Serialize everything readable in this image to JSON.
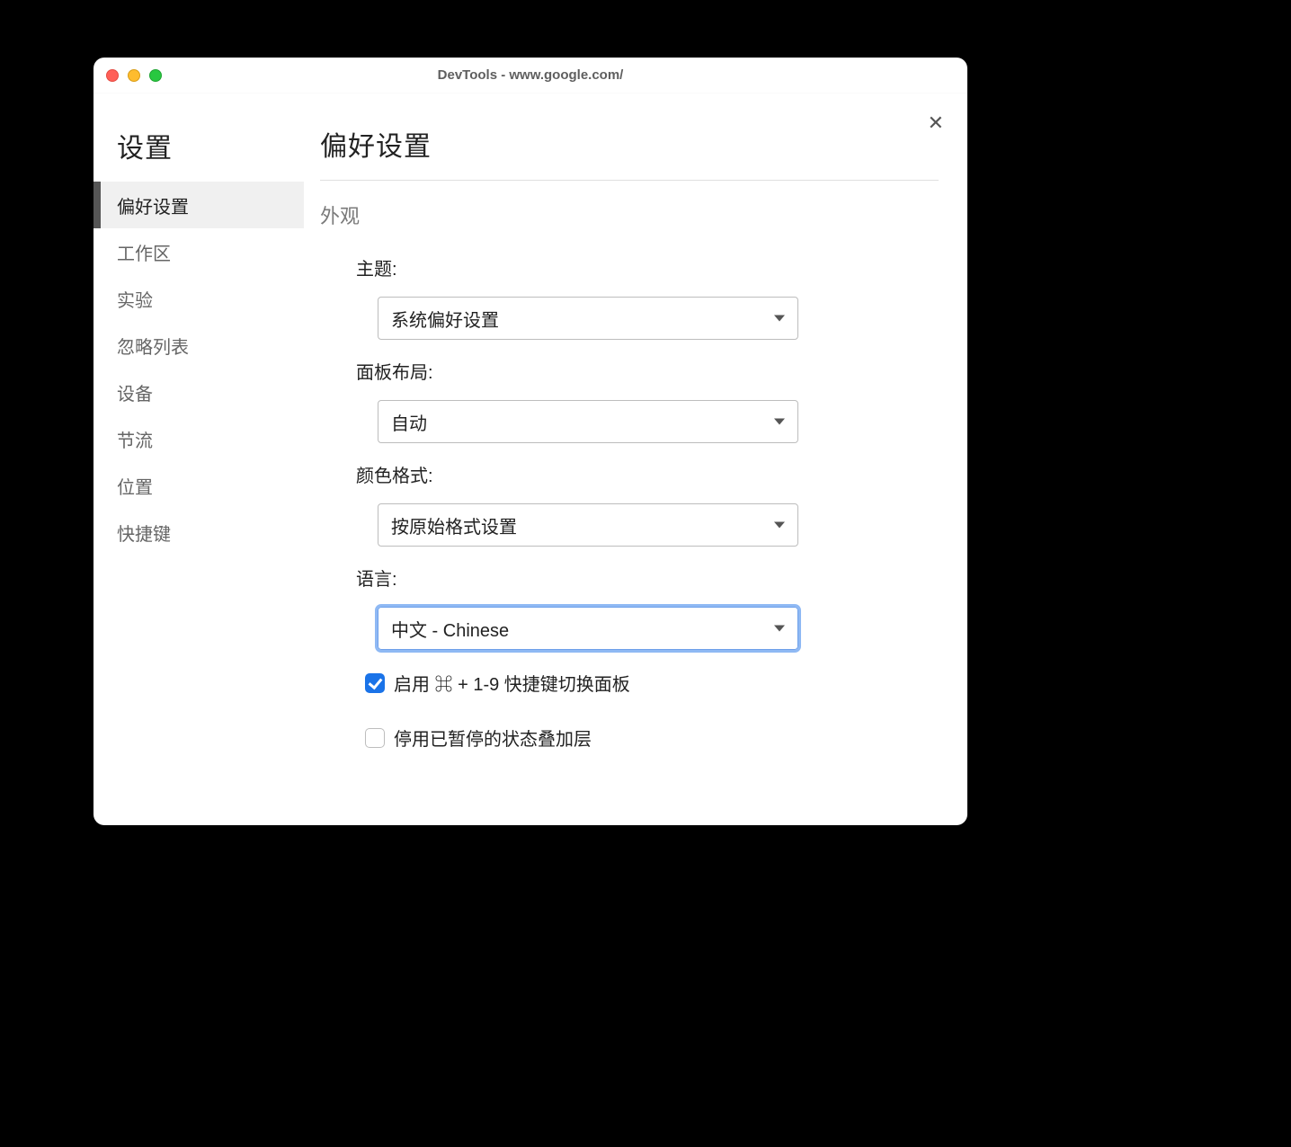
{
  "window": {
    "title": "DevTools - www.google.com/"
  },
  "sidebar": {
    "title": "设置",
    "items": [
      {
        "label": "偏好设置",
        "active": true
      },
      {
        "label": "工作区",
        "active": false
      },
      {
        "label": "实验",
        "active": false
      },
      {
        "label": "忽略列表",
        "active": false
      },
      {
        "label": "设备",
        "active": false
      },
      {
        "label": "节流",
        "active": false
      },
      {
        "label": "位置",
        "active": false
      },
      {
        "label": "快捷键",
        "active": false
      }
    ]
  },
  "main": {
    "title": "偏好设置",
    "section": "外观",
    "fields": {
      "theme": {
        "label": "主题:",
        "value": "系统偏好设置"
      },
      "panelLayout": {
        "label": "面板布局:",
        "value": "自动"
      },
      "colorFormat": {
        "label": "颜色格式:",
        "value": "按原始格式设置"
      },
      "language": {
        "label": "语言:",
        "value": "中文 - Chinese"
      }
    },
    "checkboxes": {
      "shortcut": {
        "label": "启用 ⌘ + 1-9 快捷键切换面板",
        "checked": true
      },
      "overlay": {
        "label": "停用已暂停的状态叠加层",
        "checked": false
      }
    }
  }
}
